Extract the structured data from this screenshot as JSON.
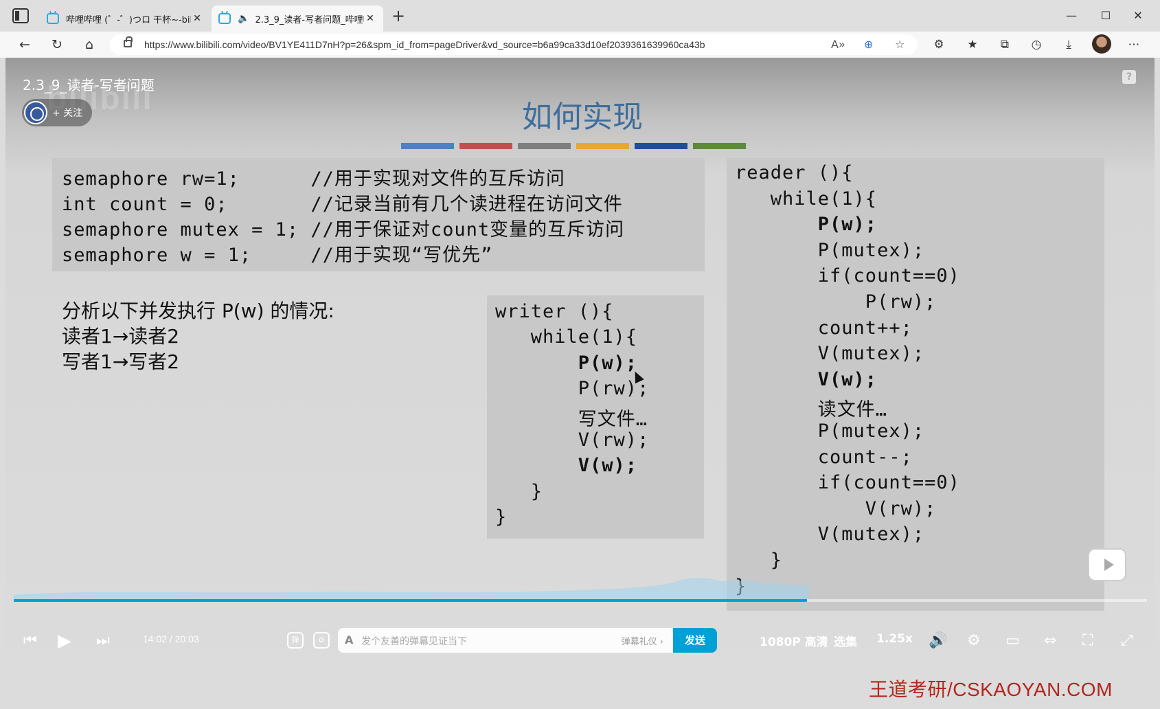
{
  "browser": {
    "tabs": [
      {
        "title": "哔哩哔哩 (゜-゜)つロ 干杯~-bili",
        "active": false
      },
      {
        "title": "2.3_9_读者-写者问题_哔哩哔",
        "active": true
      }
    ],
    "url": "https://www.bilibili.com/video/BV1YE411D7nH?p=26&spm_id_from=pageDriver&vd_source=b6a99ca33d10ef2039361639960ca43b",
    "window_controls": [
      "minimize",
      "maximize",
      "close"
    ]
  },
  "player": {
    "video_title": "2.3_9_读者-写者问题",
    "follow_label": "+ 关注",
    "watermark_logo": "bilibili",
    "current_time": "14:02",
    "time_separator": "/",
    "duration": "20:03",
    "progress_fraction": 0.7,
    "danmaku_placeholder": "发个友善的弹幕见证当下",
    "danmaku_etiquette": "弹幕礼仪 ›",
    "send_label": "发送",
    "quality": "1080P 高清",
    "episodes": "选集",
    "speed": "1.25x",
    "corner_watermark": "王道考研/CSKAOYAN.COM",
    "accent_color": "#00a1d6"
  },
  "slide": {
    "title": "如何实现",
    "bar_colors": [
      "#4f81bd",
      "#c0504d",
      "#7f7f7f",
      "#e8a830",
      "#1f4e99",
      "#5b8a3c"
    ],
    "declarations": [
      "semaphore rw=1;      //用于实现对文件的互斥访问",
      "int count = 0;       //记录当前有几个读进程在访问文件",
      "semaphore mutex = 1; //用于保证对count变量的互斥访问",
      "semaphore w = 1;     //用于实现“写优先”"
    ],
    "analysis": [
      "分析以下并发执行 P(w) 的情况:",
      "读者1→读者2",
      "写者1→写者2"
    ],
    "writer": [
      {
        "text": "writer (){",
        "bold": false
      },
      {
        "text": "   while(1){",
        "bold": false
      },
      {
        "text": "       P(w);",
        "bold": true
      },
      {
        "text": "       P(rw);",
        "bold": false
      },
      {
        "text": "       写文件…",
        "bold": false
      },
      {
        "text": "       V(rw);",
        "bold": false
      },
      {
        "text": "       V(w);",
        "bold": true
      },
      {
        "text": "   }",
        "bold": false
      },
      {
        "text": "}",
        "bold": false
      }
    ],
    "reader": [
      {
        "text": "reader (){",
        "bold": false
      },
      {
        "text": "   while(1){",
        "bold": false
      },
      {
        "text": "       P(w);",
        "bold": true
      },
      {
        "text": "       P(mutex);",
        "bold": false
      },
      {
        "text": "       if(count==0)",
        "bold": false
      },
      {
        "text": "           P(rw);",
        "bold": false
      },
      {
        "text": "       count++;",
        "bold": false
      },
      {
        "text": "       V(mutex);",
        "bold": false
      },
      {
        "text": "       V(w);",
        "bold": true
      },
      {
        "text": "       读文件…",
        "bold": false
      },
      {
        "text": "       P(mutex);",
        "bold": false
      },
      {
        "text": "       count--;",
        "bold": false
      },
      {
        "text": "       if(count==0)",
        "bold": false
      },
      {
        "text": "           V(rw);",
        "bold": false
      },
      {
        "text": "       V(mutex);",
        "bold": false
      },
      {
        "text": "   }",
        "bold": false
      },
      {
        "text": "}",
        "bold": false
      }
    ]
  }
}
